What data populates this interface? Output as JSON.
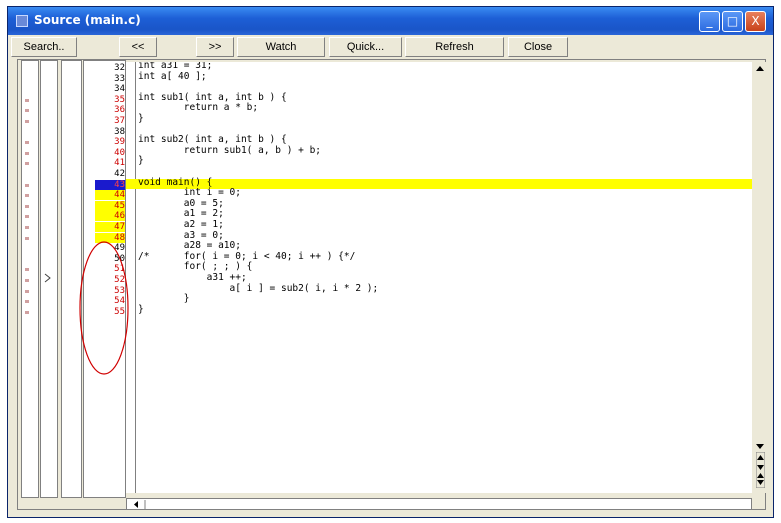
{
  "window": {
    "title": "Source (main.c)"
  },
  "toolbar": {
    "search": "Search..",
    "prev": "<<",
    "next": ">>",
    "watch": "Watch",
    "quick": "Quick...",
    "refresh": "Refresh",
    "close": "Close"
  },
  "titlebar_buttons": {
    "minimize": "_",
    "maximize": "□",
    "close": "X"
  },
  "current_line": "43",
  "lines": [
    {
      "n": "32",
      "code": "int a31 = 31;",
      "bp": false,
      "hl": false,
      "mark": false
    },
    {
      "n": "33",
      "code": "int a[ 40 ];",
      "bp": false,
      "hl": false,
      "mark": false
    },
    {
      "n": "34",
      "code": "",
      "bp": false,
      "hl": false,
      "mark": false
    },
    {
      "n": "35",
      "code": "int sub1( int a, int b ) {",
      "bp": false,
      "hl": false,
      "mark": true
    },
    {
      "n": "36",
      "code": "        return a * b;",
      "bp": false,
      "hl": false,
      "mark": true
    },
    {
      "n": "37",
      "code": "}",
      "bp": false,
      "hl": false,
      "mark": true
    },
    {
      "n": "38",
      "code": "",
      "bp": false,
      "hl": false,
      "mark": false
    },
    {
      "n": "39",
      "code": "int sub2( int a, int b ) {",
      "bp": false,
      "hl": false,
      "mark": true
    },
    {
      "n": "40",
      "code": "        return sub1( a, b ) + b;",
      "bp": false,
      "hl": false,
      "mark": true
    },
    {
      "n": "41",
      "code": "}",
      "bp": false,
      "hl": false,
      "mark": true
    },
    {
      "n": "42",
      "code": "",
      "bp": false,
      "hl": false,
      "mark": false
    },
    {
      "n": "43",
      "code": "void main() {",
      "bp": true,
      "hl": true,
      "mark": true
    },
    {
      "n": "44",
      "code": "        int i = 0;",
      "bp": false,
      "hl": false,
      "mark": true
    },
    {
      "n": "45",
      "code": "        a0 = 5;",
      "bp": false,
      "hl": false,
      "mark": true
    },
    {
      "n": "46",
      "code": "        a1 = 2;",
      "bp": false,
      "hl": false,
      "mark": true
    },
    {
      "n": "47",
      "code": "        a2 = 1;",
      "bp": false,
      "hl": false,
      "mark": true
    },
    {
      "n": "48",
      "code": "        a3 = 0;",
      "bp": false,
      "hl": false,
      "mark": true
    },
    {
      "n": "49",
      "code": "        a28 = a10;",
      "bp": false,
      "hl": false,
      "mark": false
    },
    {
      "n": "50",
      "code": "/*      for( i = 0; i < 40; i ++ ) {*/",
      "bp": false,
      "hl": false,
      "mark": false
    },
    {
      "n": "51",
      "code": "        for( ; ; ) {",
      "bp": false,
      "hl": false,
      "mark": true
    },
    {
      "n": "52",
      "code": "            a31 ++;",
      "bp": false,
      "hl": false,
      "mark": true
    },
    {
      "n": "53",
      "code": "                a[ i ] = sub2( i, i * 2 );",
      "bp": false,
      "hl": false,
      "mark": true
    },
    {
      "n": "54",
      "code": "        }",
      "bp": false,
      "hl": false,
      "mark": true
    },
    {
      "n": "55",
      "code": "}",
      "bp": false,
      "hl": false,
      "mark": true
    }
  ]
}
